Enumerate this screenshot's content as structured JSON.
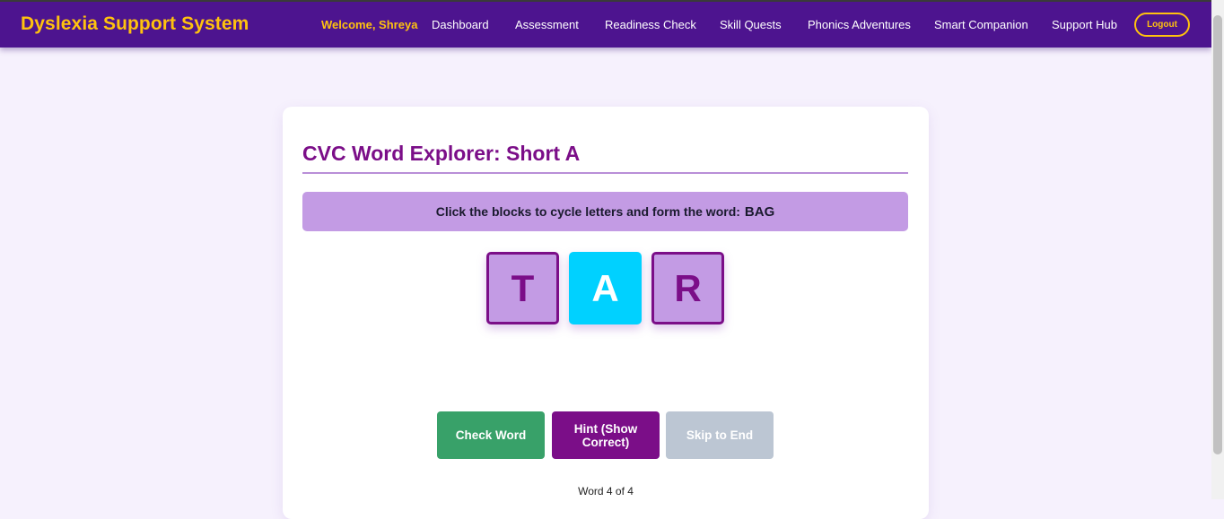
{
  "header": {
    "brand": "Dyslexia Support System",
    "welcome": "Welcome, Shreya",
    "nav": [
      {
        "label": "Dashboard"
      },
      {
        "label": "Assessment"
      },
      {
        "label": "Readiness Check"
      },
      {
        "label": "Skill Quests"
      },
      {
        "label": "Phonics Adventures"
      },
      {
        "label": "Smart Companion"
      },
      {
        "label": "Support Hub"
      }
    ],
    "logout_label": "Logout"
  },
  "activity": {
    "title": "CVC Word Explorer: Short A",
    "instruction_prefix": "Click the blocks to cycle letters and form the word:",
    "target_word": "BAG",
    "blocks": [
      {
        "letter": "T",
        "state": "normal"
      },
      {
        "letter": "A",
        "state": "active"
      },
      {
        "letter": "R",
        "state": "normal"
      }
    ],
    "buttons": {
      "check": "Check Word",
      "hint": "Hint (Show Correct)",
      "skip": "Skip to End"
    },
    "progress": "Word 4 of 4"
  },
  "colors": {
    "header_bg": "#4d148f",
    "brand_yellow": "#ffc20e",
    "accent_purple": "#7b0e88",
    "block_lavender": "#c39be4",
    "block_active": "#00d1ff",
    "check_green": "#38a169",
    "skip_gray": "#bcc6d3"
  }
}
